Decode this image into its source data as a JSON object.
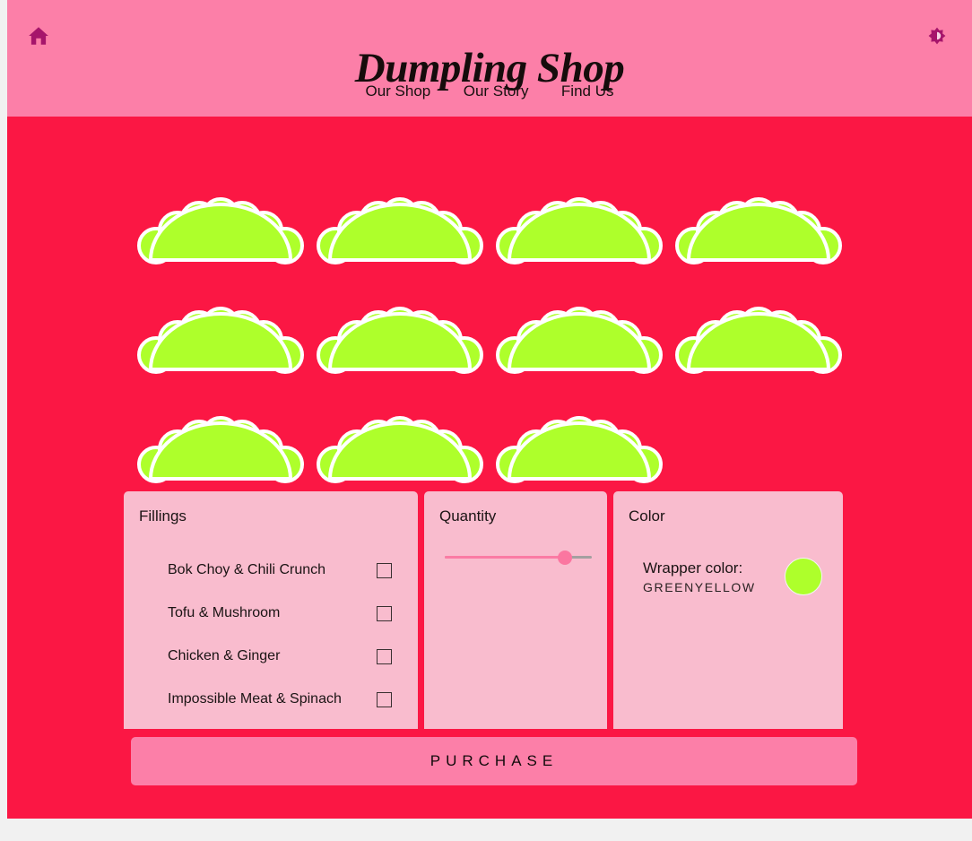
{
  "header": {
    "title": "Dumpling Shop",
    "home_icon": "home-icon",
    "brightness_icon": "brightness-icon",
    "nav": [
      {
        "label": "Our Shop"
      },
      {
        "label": "Our Story"
      },
      {
        "label": "Find Us"
      }
    ]
  },
  "display": {
    "dumpling_count": 11,
    "rows": [
      4,
      4,
      3
    ],
    "wrapper_fill": "#aeff2b",
    "wrapper_outline": "#ffffff",
    "stage_background": "#fb1744"
  },
  "panels": {
    "fillings": {
      "legend": "Fillings",
      "options": [
        {
          "label": "Bok Choy & Chili Crunch",
          "checked": false
        },
        {
          "label": "Tofu & Mushroom",
          "checked": false
        },
        {
          "label": "Chicken & Ginger",
          "checked": false
        },
        {
          "label": "Impossible Meat & Spinach",
          "checked": false
        }
      ]
    },
    "quantity": {
      "legend": "Quantity",
      "slider_percent": 82
    },
    "color": {
      "legend": "Color",
      "wrapper_color_label": "Wrapper color:",
      "wrapper_color_value": "GREENYELLOW",
      "swatch_hex": "#aeff2b"
    }
  },
  "purchase": {
    "label": "PURCHASE"
  },
  "theme": {
    "header_pink": "#fc7fa8",
    "body_red": "#fb1744",
    "panel_pink": "#f9bcce",
    "icon_magenta": "#a6156b"
  }
}
